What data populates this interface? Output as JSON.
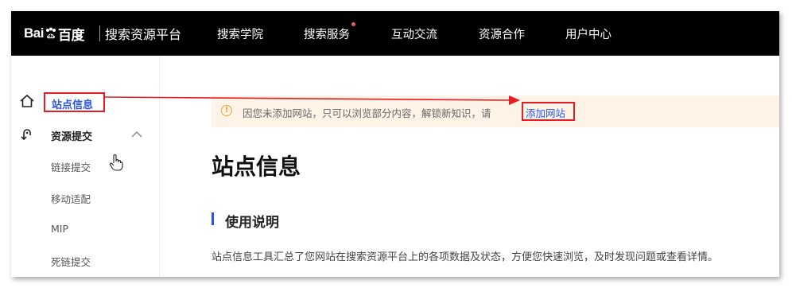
{
  "topnav": {
    "logo_text_left": "Bai",
    "logo_text_right": "百度",
    "platform_name": "搜索资源平台",
    "items": [
      {
        "label": "搜索学院"
      },
      {
        "label": "搜索服务"
      },
      {
        "label": "互动交流"
      },
      {
        "label": "资源合作"
      },
      {
        "label": "用户中心"
      }
    ]
  },
  "sidebar": {
    "site_info_label": "站点信息",
    "resource_group_label": "资源提交",
    "sub_items": [
      {
        "label": "链接提交"
      },
      {
        "label": "移动适配"
      },
      {
        "label": "MIP"
      },
      {
        "label": "死链提交"
      }
    ]
  },
  "notice": {
    "text": "因您未添加网站，只可以浏览部分内容，解锁新知识，请",
    "link": "添加网站"
  },
  "main": {
    "title": "站点信息",
    "section_title": "使用说明",
    "description": "站点信息工具汇总了您网站在搜索资源平台上的各项数据及状态，方便您快速浏览，及时发现问题或查看详情。"
  },
  "colors": {
    "nav_bg": "#000000",
    "accent": "#2a56e8",
    "annotation": "#e51c23",
    "notice_bg": "#fdf3e7",
    "warning": "#f0a13c"
  }
}
